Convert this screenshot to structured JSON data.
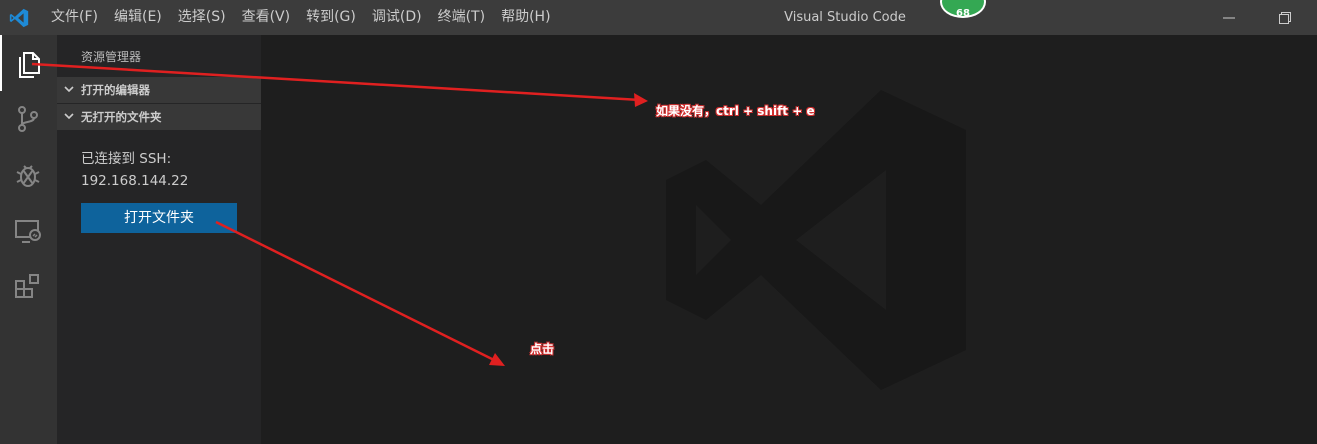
{
  "app": {
    "window_title": "Visual Studio Code",
    "notification_count": "68",
    "logo_icon": "vscode-logo-icon",
    "accent_color": "#0e639c"
  },
  "menu": [
    "文件(F)",
    "编辑(E)",
    "选择(S)",
    "查看(V)",
    "转到(G)",
    "调试(D)",
    "终端(T)",
    "帮助(H)"
  ],
  "activity_bar": {
    "items": [
      {
        "icon": "files-icon",
        "active": true
      },
      {
        "icon": "source-control-icon",
        "active": false
      },
      {
        "icon": "debug-icon",
        "active": false
      },
      {
        "icon": "remote-explorer-icon",
        "active": false
      },
      {
        "icon": "extensions-icon",
        "active": false
      }
    ]
  },
  "sidebar": {
    "title": "资源管理器",
    "sections": [
      "打开的编辑器",
      "无打开的文件夹"
    ],
    "ssh_line1": "已连接到 SSH:",
    "ssh_line2": "192.168.144.22",
    "open_folder_button": "打开文件夹"
  },
  "annotations": {
    "tip": "如果没有，ctrl + shift  + e",
    "click": "点击",
    "color": "#e02020"
  }
}
